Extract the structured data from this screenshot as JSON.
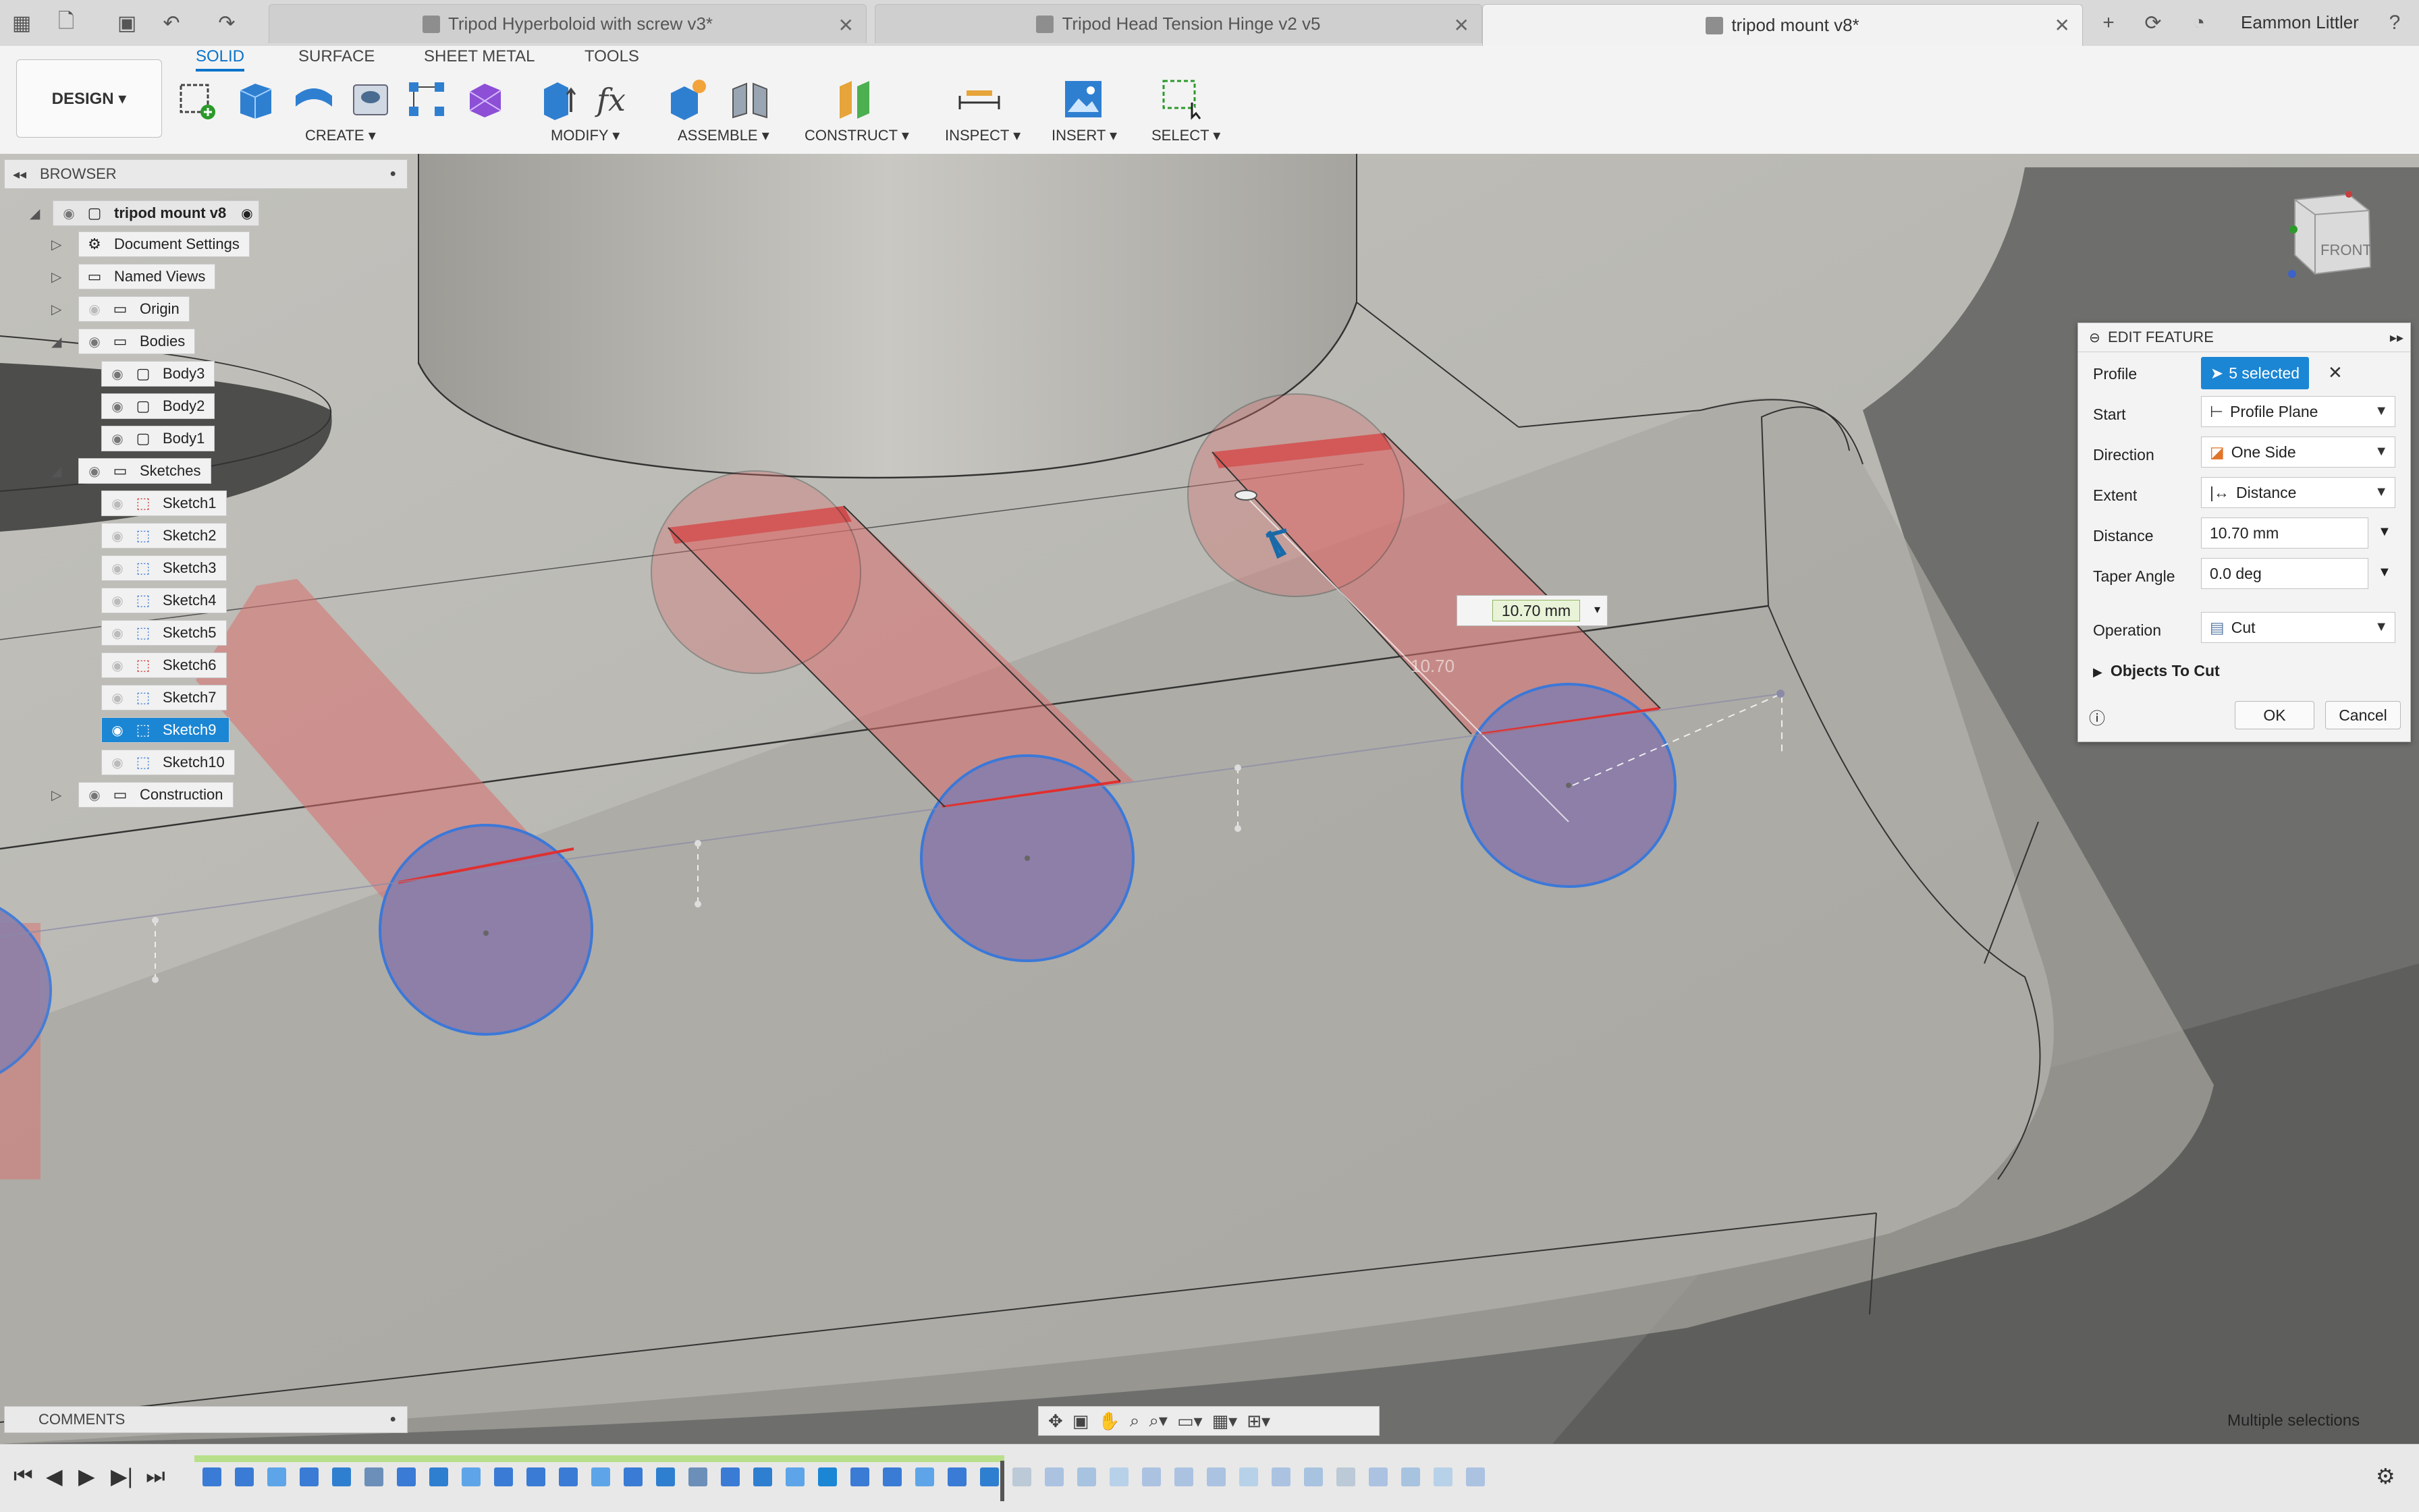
{
  "tabs": [
    {
      "label": "Tripod Hyperboloid with screw v3*",
      "active": false
    },
    {
      "label": "Tripod Head Tension Hinge v2 v5",
      "active": false
    },
    {
      "label": "tripod mount v8*",
      "active": true
    }
  ],
  "user": "Eammon Littler",
  "toolbar": {
    "design_label": "DESIGN ▾",
    "workspace_tabs": [
      "SOLID",
      "SURFACE",
      "SHEET METAL",
      "TOOLS"
    ],
    "groups": [
      "CREATE ▾",
      "MODIFY ▾",
      "ASSEMBLE ▾",
      "CONSTRUCT ▾",
      "INSPECT ▾",
      "INSERT ▾",
      "SELECT ▾"
    ]
  },
  "browser": {
    "title": "BROWSER",
    "root": "tripod mount v8",
    "items": [
      {
        "label": "Document Settings",
        "icon": "gear-icon"
      },
      {
        "label": "Named Views",
        "icon": "folder-icon"
      },
      {
        "label": "Origin",
        "icon": "folder-icon"
      },
      {
        "label": "Bodies",
        "icon": "folder-icon"
      },
      {
        "label": "Body3",
        "icon": "body-icon"
      },
      {
        "label": "Body2",
        "icon": "body-icon"
      },
      {
        "label": "Body1",
        "icon": "body-icon"
      },
      {
        "label": "Sketches",
        "icon": "folder-icon"
      },
      {
        "label": "Sketch1",
        "icon": "sketch-icon"
      },
      {
        "label": "Sketch2",
        "icon": "sketch-icon"
      },
      {
        "label": "Sketch3",
        "icon": "sketch-icon"
      },
      {
        "label": "Sketch4",
        "icon": "sketch-icon"
      },
      {
        "label": "Sketch5",
        "icon": "sketch-icon"
      },
      {
        "label": "Sketch6",
        "icon": "sketch-icon"
      },
      {
        "label": "Sketch7",
        "icon": "sketch-icon"
      },
      {
        "label": "Sketch9",
        "icon": "sketch-icon",
        "selected": true
      },
      {
        "label": "Sketch10",
        "icon": "sketch-icon"
      },
      {
        "label": "Construction",
        "icon": "folder-icon"
      }
    ]
  },
  "comments_label": "COMMENTS",
  "edit_feature": {
    "title": "EDIT FEATURE",
    "profile_label": "Profile",
    "profile_value": "5 selected",
    "start_label": "Start",
    "start_value": "Profile Plane",
    "direction_label": "Direction",
    "direction_value": "One Side",
    "extent_label": "Extent",
    "extent_value": "Distance",
    "distance_label": "Distance",
    "distance_value": "10.70 mm",
    "taper_label": "Taper Angle",
    "taper_value": "0.0 deg",
    "operation_label": "Operation",
    "operation_value": "Cut",
    "objects_to_cut": "Objects To Cut",
    "ok": "OK",
    "cancel": "Cancel"
  },
  "viewport": {
    "dimension_input": "10.70 mm",
    "ghost_dimension": "10.70",
    "viewcube_label": "FRONT"
  },
  "status_text": "Multiple selections",
  "colors": {
    "accent": "#1b86d4",
    "cut_face": "#d9706e",
    "selected_profile": "#8d7fa8",
    "model": "#b4b3ad"
  }
}
